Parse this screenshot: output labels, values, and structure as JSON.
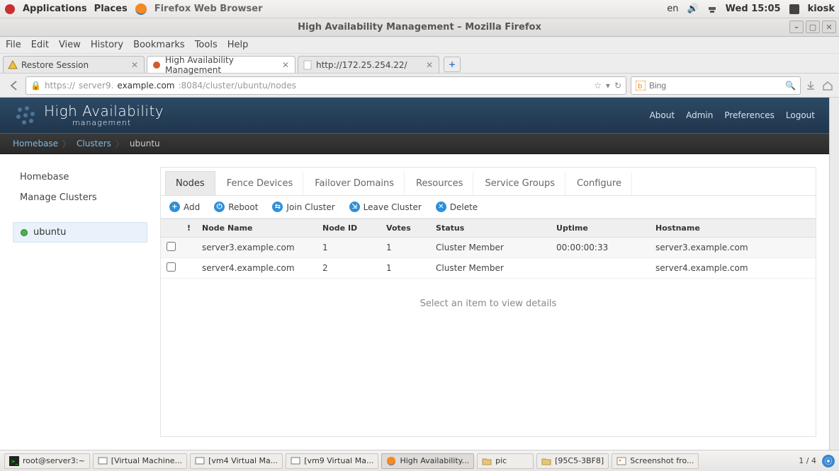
{
  "gnome": {
    "applications": "Applications",
    "places": "Places",
    "browser_label": "Firefox Web Browser",
    "lang": "en",
    "clock": "Wed 15:05",
    "user": "kiosk"
  },
  "window": {
    "title": "High Availability Management – Mozilla Firefox"
  },
  "ff_menu": {
    "file": "File",
    "edit": "Edit",
    "view": "View",
    "history": "History",
    "bookmarks": "Bookmarks",
    "tools": "Tools",
    "help": "Help"
  },
  "tabs": [
    {
      "label": "Restore Session"
    },
    {
      "label": "High Availability Management"
    },
    {
      "label": "http://172.25.254.22/"
    }
  ],
  "url": {
    "scheme": "https://",
    "host": "server9.",
    "domain": "example.com",
    "port_path": ":8084/cluster/ubuntu/nodes"
  },
  "search": {
    "placeholder": "Bing"
  },
  "app": {
    "title": "High Availability",
    "subtitle": "management",
    "links": [
      "About",
      "Admin",
      "Preferences",
      "Logout"
    ]
  },
  "breadcrumb": [
    "Homebase",
    "Clusters",
    "ubuntu"
  ],
  "sidebar": {
    "links": [
      "Homebase",
      "Manage Clusters"
    ],
    "cluster": "ubuntu"
  },
  "content_tabs": [
    "Nodes",
    "Fence Devices",
    "Failover Domains",
    "Resources",
    "Service Groups",
    "Configure"
  ],
  "actions": {
    "add": "Add",
    "reboot": "Reboot",
    "join": "Join Cluster",
    "leave": "Leave Cluster",
    "delete": "Delete"
  },
  "table": {
    "headers": {
      "excl": "!",
      "name": "Node Name",
      "id": "Node ID",
      "votes": "Votes",
      "status": "Status",
      "uptime": "Uptime",
      "hostname": "Hostname"
    },
    "rows": [
      {
        "name": "server3.example.com",
        "id": "1",
        "votes": "1",
        "status": "Cluster Member",
        "uptime": "00:00:00:33",
        "hostname": "server3.example.com"
      },
      {
        "name": "server4.example.com",
        "id": "2",
        "votes": "1",
        "status": "Cluster Member",
        "uptime": "",
        "hostname": "server4.example.com"
      }
    ]
  },
  "detail_hint": "Select an item to view details",
  "taskbar": {
    "items": [
      "root@server3:~",
      "[Virtual Machine...",
      "[vm4 Virtual Ma...",
      "[vm9 Virtual Ma...",
      "High Availability...",
      "pic",
      "[95C5-3BF8]",
      "Screenshot fro..."
    ],
    "ws": "1 / 4"
  }
}
